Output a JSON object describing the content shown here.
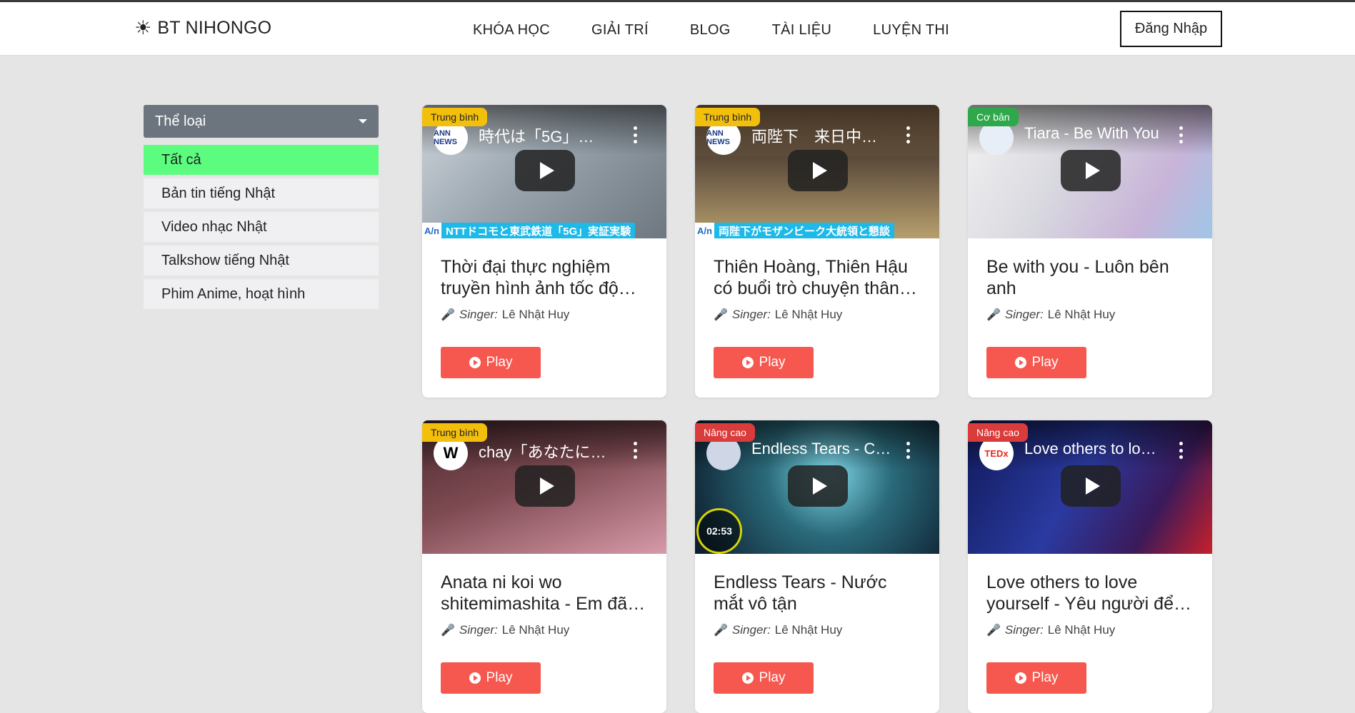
{
  "nav": {
    "brand": "BT NIHONGO",
    "brand_icon": "sun-icon",
    "menu": [
      "KHÓA HỌC",
      "GIẢI TRÍ",
      "BLOG",
      "TÀI LIỆU",
      "LUYỆN THI"
    ],
    "login": "Đăng Nhập"
  },
  "sidebar": {
    "select_label": "Thể loại",
    "items": [
      {
        "label": "Tất cả",
        "active": true
      },
      {
        "label": "Bản tin tiếng Nhật"
      },
      {
        "label": "Video nhạc Nhật"
      },
      {
        "label": "Talkshow tiếng Nhật"
      },
      {
        "label": "Phim Anime, hoạt hình"
      }
    ],
    "active_color": "#5cfd7f"
  },
  "colors": {
    "play_button": "#f6584f",
    "level_mid": "#f3bf0d",
    "level_basic": "#2ea84a",
    "level_adv": "#da3b3b"
  },
  "cards": [
    {
      "level": "Trung bình",
      "video_title": "時代は「5G」…",
      "channel": "ANN NEWS",
      "caption": "NTTドコモと東武鉄道「5G」実証実験",
      "caption_mark": "A/n",
      "title": "Thời đại thực nghiệm truyền hình ảnh tốc độ c…",
      "singer_label": "Singer:",
      "singer": "Lê Nhật Huy",
      "button": "Play"
    },
    {
      "level": "Trung bình",
      "video_title": "両陛下　来日中…",
      "channel": "ANN NEWS",
      "caption": "両陛下がモザンビーク大統領と懇談",
      "caption_mark": "A/n",
      "title": "Thiên Hoàng, Thiên Hậu có buổi trò chuyện thân …",
      "singer_label": "Singer:",
      "singer": "Lê Nhật Huy",
      "button": "Play"
    },
    {
      "level": "Cơ bản",
      "video_title": "Tiara - Be With You",
      "title": "Be with you - Luôn bên anh",
      "singer_label": "Singer:",
      "singer": "Lê Nhật Huy",
      "button": "Play"
    },
    {
      "level": "Trung bình",
      "video_title": "chay「あなたに…",
      "title": "Anata ni koi wo shitemimashita - Em đã …",
      "singer_label": "Singer:",
      "singer": "Lê Nhật Huy",
      "button": "Play"
    },
    {
      "level": "Nâng cao",
      "video_title": "Endless Tears - C…",
      "timer": "02:53",
      "title": "Endless Tears - Nước mắt vô tận",
      "singer_label": "Singer:",
      "singer": "Lê Nhật Huy",
      "button": "Play"
    },
    {
      "level": "Nâng cao",
      "video_title": "Love others to lo…",
      "channel": "TEDx",
      "title": "Love others to love yourself - Yêu người để t…",
      "singer_label": "Singer:",
      "singer": "Lê Nhật Huy",
      "button": "Play"
    }
  ]
}
